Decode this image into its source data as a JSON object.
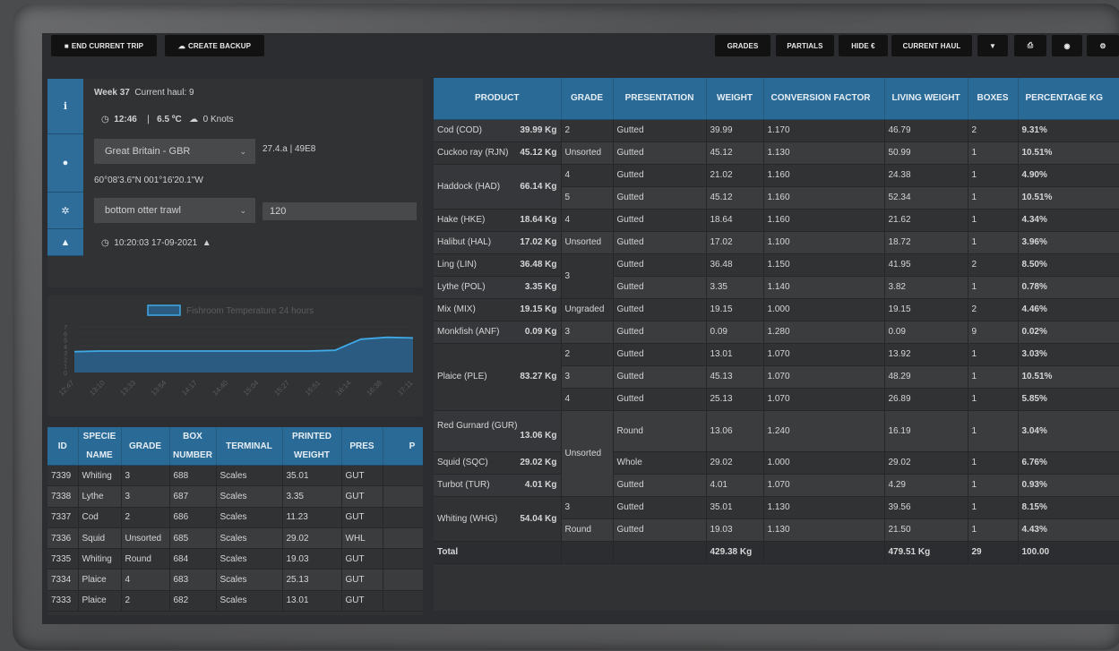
{
  "toolbar": {
    "left": [
      {
        "label": "END CURRENT TRIP",
        "icon": "stop-icon"
      },
      {
        "label": "CREATE BACKUP",
        "icon": "cloud-icon"
      }
    ],
    "right": [
      {
        "label": "GRADES"
      },
      {
        "label": "PARTIALS"
      },
      {
        "label": "HIDE €"
      },
      {
        "label": "CURRENT HAUL"
      }
    ],
    "icon_buttons": [
      "filter-icon",
      "print-icon",
      "eye-icon",
      "settings-icon"
    ]
  },
  "haul": {
    "week": "Week 37",
    "current_haul": "Current haul: 9",
    "time": "12:46",
    "temperature": "6.5 ºC",
    "wind": "0 Knots",
    "country": "Great Britain - GBR",
    "area": "27.4.a | 49E8",
    "coords": "60°08'3.6\"N 001°16'20.1\"W",
    "gear": "bottom otter trawl",
    "mesh": "120",
    "timestamp": "10:20:03 17-09-2021"
  },
  "chart_data": {
    "type": "line",
    "legend": [
      "Fishroom Temperature 24 hours"
    ],
    "x": [
      "12:47",
      "13:10",
      "13:33",
      "13:54",
      "14:17",
      "14:40",
      "15:04",
      "15:27",
      "15:51",
      "16:14",
      "16:38",
      "17:11"
    ],
    "series": [
      {
        "name": "Fishroom Temperature 24 hours",
        "values": [
          3.2,
          3.3,
          3.3,
          3.3,
          3.3,
          3.3,
          3.3,
          3.3,
          3.3,
          3.3,
          3.4,
          5.1,
          5.4,
          5.3
        ]
      }
    ],
    "ylabel": "",
    "ylim": [
      0,
      7
    ]
  },
  "boxes": {
    "headers": [
      "ID",
      "SPECIE NAME",
      "GRADE",
      "BOX NUMBER",
      "TERMINAL",
      "PRINTED WEIGHT",
      "PRES",
      "P"
    ],
    "rows": [
      [
        "7339",
        "Whiting",
        "3",
        "688",
        "Scales",
        "35.01",
        "GUT"
      ],
      [
        "7338",
        "Lythe",
        "3",
        "687",
        "Scales",
        "3.35",
        "GUT"
      ],
      [
        "7337",
        "Cod",
        "2",
        "686",
        "Scales",
        "11.23",
        "GUT"
      ],
      [
        "7336",
        "Squid",
        "Unsorted",
        "685",
        "Scales",
        "29.02",
        "WHL"
      ],
      [
        "7335",
        "Whiting",
        "Round",
        "684",
        "Scales",
        "19.03",
        "GUT"
      ],
      [
        "7334",
        "Plaice",
        "4",
        "683",
        "Scales",
        "25.13",
        "GUT"
      ],
      [
        "7333",
        "Plaice",
        "2",
        "682",
        "Scales",
        "13.01",
        "GUT"
      ]
    ]
  },
  "products": {
    "headers": [
      "PRODUCT",
      "GRADE",
      "PRESENTATION",
      "WEIGHT",
      "CONVERSION FACTOR",
      "LIVING WEIGHT",
      "BOXES",
      "PERCENTAGE KG"
    ],
    "groups": [
      {
        "name": "Cod (COD)",
        "total": "39.99 Kg",
        "rows": [
          [
            "2",
            "Gutted",
            "39.99",
            "1.170",
            "46.79",
            "2",
            "9.31%"
          ]
        ]
      },
      {
        "name": "Cuckoo ray (RJN)",
        "total": "45.12 Kg",
        "rows": [
          [
            "Unsorted",
            "Gutted",
            "45.12",
            "1.130",
            "50.99",
            "1",
            "10.51%"
          ]
        ]
      },
      {
        "name": "Haddock (HAD)",
        "total": "66.14 Kg",
        "rows": [
          [
            "4",
            "Gutted",
            "21.02",
            "1.160",
            "24.38",
            "1",
            "4.90%"
          ],
          [
            "5",
            "Gutted",
            "45.12",
            "1.160",
            "52.34",
            "1",
            "10.51%"
          ]
        ]
      },
      {
        "name": "Hake (HKE)",
        "total": "18.64 Kg",
        "rows": [
          [
            "4",
            "Gutted",
            "18.64",
            "1.160",
            "21.62",
            "1",
            "4.34%"
          ]
        ]
      },
      {
        "name": "Halibut (HAL)",
        "total": "17.02 Kg",
        "rows": [
          [
            "Unsorted",
            "Gutted",
            "17.02",
            "1.100",
            "18.72",
            "1",
            "3.96%"
          ]
        ]
      },
      {
        "name": "Ling (LIN)",
        "total": "36.48 Kg",
        "rows": [
          [
            "3",
            "Gutted",
            "36.48",
            "1.150",
            "41.95",
            "2",
            "8.50%"
          ]
        ]
      },
      {
        "name": "Lythe (POL)",
        "total": "3.35 Kg",
        "rows": [
          [
            "",
            "Gutted",
            "3.35",
            "1.140",
            "3.82",
            "1",
            "0.78%"
          ]
        ]
      },
      {
        "name": "Mix (MIX)",
        "total": "19.15 Kg",
        "rows": [
          [
            "Ungraded",
            "Gutted",
            "19.15",
            "1.000",
            "19.15",
            "2",
            "4.46%"
          ]
        ]
      },
      {
        "name": "Monkfish (ANF)",
        "total": "0.09 Kg",
        "rows": [
          [
            "3",
            "Gutted",
            "0.09",
            "1.280",
            "0.09",
            "9",
            "0.02%"
          ]
        ]
      },
      {
        "name": "Plaice (PLE)",
        "total": "83.27 Kg",
        "rows": [
          [
            "2",
            "Gutted",
            "13.01",
            "1.070",
            "13.92",
            "1",
            "3.03%"
          ],
          [
            "3",
            "Gutted",
            "45.13",
            "1.070",
            "48.29",
            "1",
            "10.51%"
          ],
          [
            "4",
            "Gutted",
            "25.13",
            "1.070",
            "26.89",
            "1",
            "5.85%"
          ]
        ]
      },
      {
        "name": "Red Gurnard (GUR)",
        "total": "13.06 Kg",
        "rows": [
          [
            "Unsorted",
            "Round",
            "13.06",
            "1.240",
            "16.19",
            "1",
            "3.04%"
          ]
        ]
      },
      {
        "name": "Squid (SQC)",
        "total": "29.02 Kg",
        "rows": [
          [
            "",
            "Whole",
            "29.02",
            "1.000",
            "29.02",
            "1",
            "6.76%"
          ]
        ]
      },
      {
        "name": "Turbot (TUR)",
        "total": "4.01 Kg",
        "rows": [
          [
            "",
            "Gutted",
            "4.01",
            "1.070",
            "4.29",
            "1",
            "0.93%"
          ]
        ]
      },
      {
        "name": "Whiting (WHG)",
        "total": "54.04 Kg",
        "rows": [
          [
            "3",
            "Gutted",
            "35.01",
            "1.130",
            "39.56",
            "1",
            "8.15%"
          ],
          [
            "Round",
            "Gutted",
            "19.03",
            "1.130",
            "21.50",
            "1",
            "4.43%"
          ]
        ]
      }
    ],
    "total": {
      "label": "Total",
      "weight": "429.38 Kg",
      "living": "479.51 Kg",
      "boxes": "29",
      "pct": "100.00"
    }
  },
  "colors": {
    "accent": "#2e6d9a",
    "chart_line": "#3fa9e6",
    "panel": "#303234"
  }
}
